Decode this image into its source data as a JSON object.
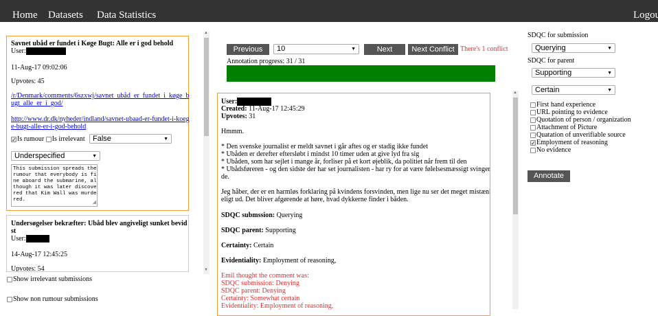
{
  "nav": {
    "home": "Home",
    "datasets": "Datasets",
    "statistics": "Data Statistics",
    "logout": "Logou"
  },
  "left": {
    "item1": {
      "title": "Savnet ubåd er fundet i Køge Bugt: Alle er i god behold",
      "user_label": "User:",
      "date": "11-Aug-17 09:02:06",
      "upvotes": "Upvotes: 45",
      "link1_line1": "/r/Denmark/comments/6szxwj/savnet_ubåd_er_fundet_i_køge_b",
      "link1_line2": "ugt_alle_er_i_god/",
      "link2_line1": "http://www.dr.dk/nyheder/indland/savnet-ubaad-er-fundet-i-koeg",
      "link2_line2": "e-bugt-alle-er-i-god-behold",
      "rumour_label": "Is rumour",
      "irrelevant_label": "Is irrelevant",
      "select_value": "False",
      "specified_value": "Underspecified",
      "textarea_lines": [
        "This submission spreads the",
        "rumour that everybody is fi",
        "ne aboard the submarine, al",
        "though it was later discove",
        "red that Kim Wall was murde",
        "red."
      ]
    },
    "item2": {
      "title_line1": "Undersøgelser bekræfter: Ubåd blev angiveligt sunket bevid",
      "title_line2": "st",
      "user_label": "User:",
      "date": "14-Aug-17 12:45:25",
      "upvotes": "Upvotes: 54"
    },
    "show_irrelevant": "Show irrelevant submissions",
    "show_non_rumour": "Show non rumour submissions"
  },
  "center": {
    "previous": "Previous",
    "dropdown_value": "10",
    "next": "Next",
    "next_conflict": "Next Conflict",
    "conflict_text": "There's 1 conflict",
    "progress_label": "Annotation progress: 31 / 31",
    "progress_fraction": 1.0,
    "progress_color": "#008000",
    "comment": {
      "user_label": "User:",
      "created_label": "Created:",
      "created_value": " 11-Aug-17 12:45:29",
      "upvotes_label": "Upvotes:",
      "upvotes_value": " 31",
      "body1": "Hmmm.",
      "bullets": [
        "* Den svenske journalist er meldt savnet i går aftes og er stadig ikke fundet",
        "* Ubåden er derefter eftersløbt i mindst 10 timer uden at give lyd fra sig",
        "* Ubåden, som har sejlet i mange år, forliser på et kort øjeblik, da politiet når frem til den",
        "* Ubådsføreren - og den sidste der har set journalisten - har ry for at være følelsesmæssigt svingen",
        "de."
      ],
      "para_lines": [
        "Jeg håber, der er en harmløs forklaring på kvindens forsvinden, men lige nu ser det meget mistænk",
        "eligt ud. Det bliver afgørende at høre, hvad dykkerne finder i båden."
      ],
      "sub_label": "SDQC submssion:",
      "sub_value": " Querying",
      "parent_label": "SDQC parent:",
      "parent_value": " Supporting",
      "cert_label": "Certainty:",
      "cert_value": " Certain",
      "evid_label": "Evidentiality:",
      "evid_value": " Employment of reasoning,",
      "conflict_lines": [
        "Emil thought the comment was:",
        "SDQC submission: Denying",
        "SDQC parent: Denying",
        "Certainty: Somewhat certain",
        "Evidentiality: Employment of reasoning,"
      ]
    }
  },
  "right": {
    "sub_label": "SDQC for submission",
    "sub_value": "Querying",
    "parent_label": "SDQC for parent",
    "parent_value": "Supporting",
    "certainty_value": "Certain",
    "evidence": [
      {
        "label": "First hand experience",
        "checked": false
      },
      {
        "label": "URL pointing to evidence",
        "checked": false
      },
      {
        "label": "Quotation of person / organization",
        "checked": false
      },
      {
        "label": "Attachment of Picture",
        "checked": false
      },
      {
        "label": "Quatation of unverifiable source",
        "checked": false
      },
      {
        "label": "Employment of reasoning",
        "checked": true
      },
      {
        "label": "No evidence",
        "checked": false
      }
    ],
    "annotate": "Annotate"
  },
  "colors": {
    "navbar": "#333333",
    "accent_border": "#f0a030",
    "button": "#555555",
    "conflict_red": "#e03030",
    "link": "#0000ee"
  }
}
